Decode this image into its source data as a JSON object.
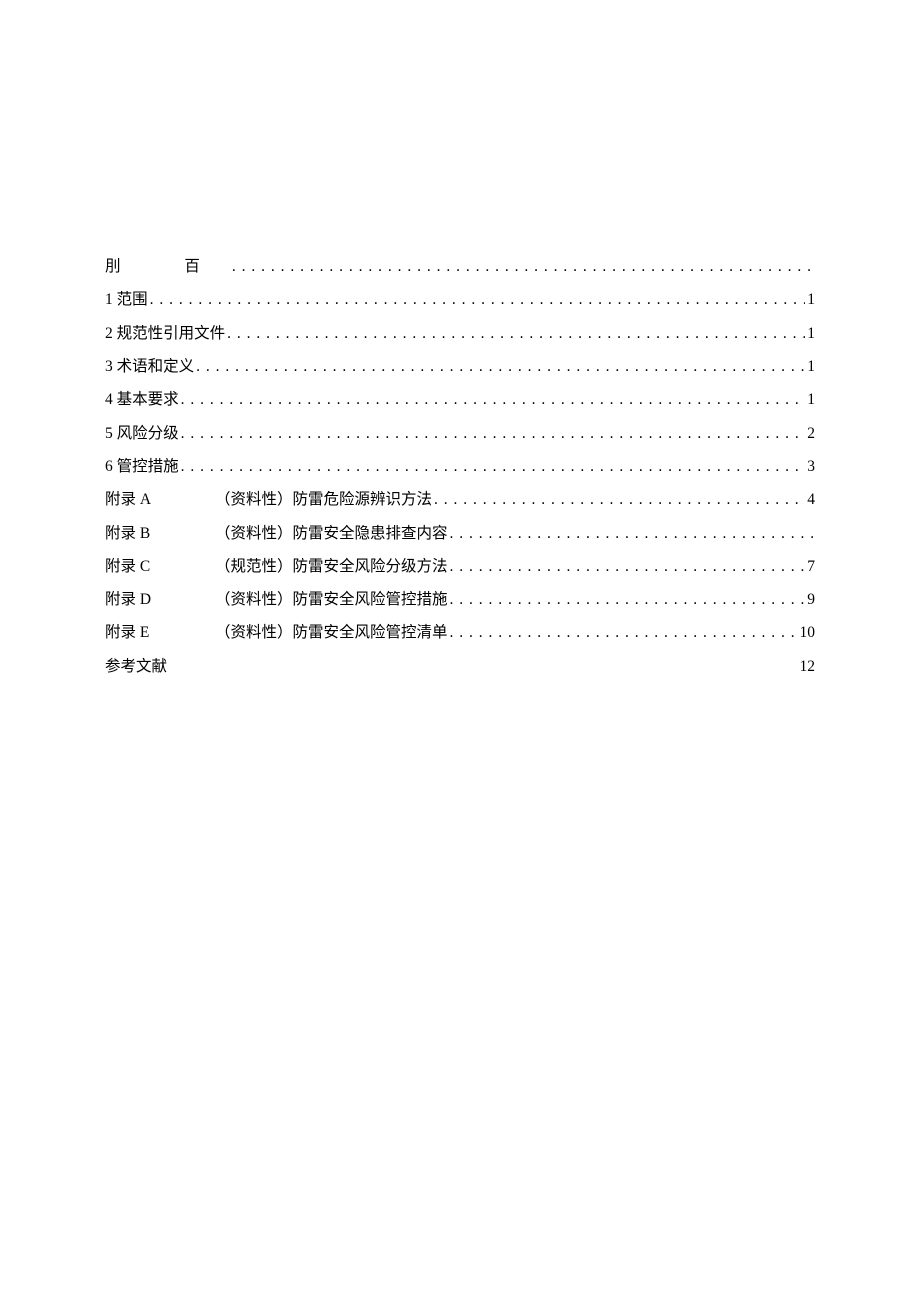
{
  "toc": {
    "entries": [
      {
        "label": "刖    百",
        "desc": "",
        "page": "",
        "type": "prefix"
      },
      {
        "label": "1 范围",
        "desc": "",
        "page": "1",
        "type": "main"
      },
      {
        "label": "2 规范性引用文件",
        "desc": "",
        "page": "1",
        "type": "main"
      },
      {
        "label": "3 术语和定义",
        "desc": "",
        "page": "1",
        "type": "main"
      },
      {
        "label": "4 基本要求",
        "desc": "",
        "page": "1",
        "type": "main"
      },
      {
        "label": "5 风险分级",
        "desc": "",
        "page": "2",
        "type": "main"
      },
      {
        "label": "6 管控措施",
        "desc": "",
        "page": "3",
        "type": "main"
      },
      {
        "label": "附录 A",
        "desc": "（资料性）防雷危险源辨识方法",
        "page": "4",
        "type": "appendix"
      },
      {
        "label": "附录 B",
        "desc": "（资料性）防雷安全隐患排查内容",
        "page": "",
        "type": "appendix"
      },
      {
        "label": "附录 C",
        "desc": "（规范性）防雷安全风险分级方法",
        "page": "7",
        "type": "appendix"
      },
      {
        "label": "附录 D",
        "desc": "（资料性）防雷安全风险管控措施",
        "page": "9",
        "type": "appendix"
      },
      {
        "label": "附录 E",
        "desc": "（资料性）防雷安全风险管控清单",
        "page": "10",
        "type": "appendix"
      },
      {
        "label": "参考文献",
        "desc": "",
        "page": "12",
        "type": "ref"
      }
    ]
  }
}
